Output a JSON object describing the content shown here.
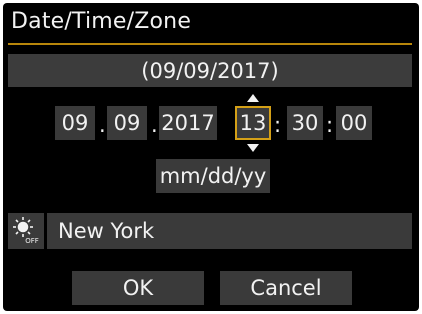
{
  "header": {
    "title": "Date/Time/Zone"
  },
  "date_display": "(09/09/2017)",
  "fields": {
    "month": "09",
    "day": "09",
    "year": "2017",
    "hour": "13",
    "minute": "30",
    "second": "00",
    "date_sep": ".",
    "time_sep": ":"
  },
  "date_format": "mm/dd/yy",
  "zone": {
    "icon": "dst-off-icon",
    "name": "New York"
  },
  "buttons": {
    "ok": "OK",
    "cancel": "Cancel"
  },
  "colors": {
    "highlight": "#d4a017",
    "background": "#000000",
    "field": "#3a3a3a"
  }
}
